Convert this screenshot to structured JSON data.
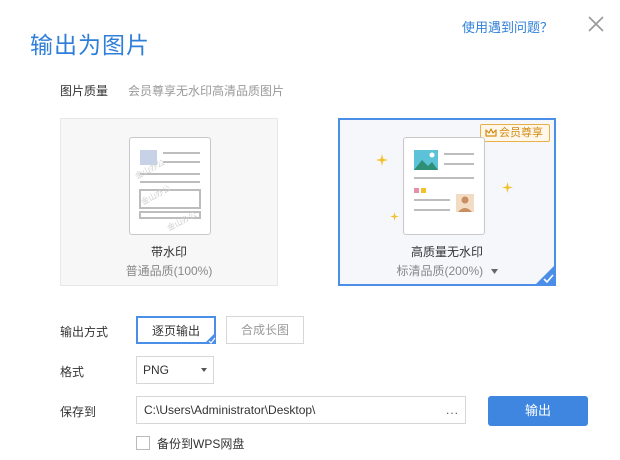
{
  "dialog": {
    "title": "输出为图片",
    "help_link": "使用遇到问题？"
  },
  "quality": {
    "label": "图片质量",
    "hint": "会员尊享无水印高清品质图片",
    "options": [
      {
        "title": "带水印",
        "subtitle": "普通品质(100%)",
        "watermark_text": "金山办公"
      },
      {
        "title": "高质量无水印",
        "subtitle": "标清品质(200%)",
        "badge": "会员尊享",
        "selected": true
      }
    ]
  },
  "output_mode": {
    "label": "输出方式",
    "options": [
      "逐页输出",
      "合成长图"
    ],
    "selected_index": 0
  },
  "format": {
    "label": "格式",
    "value": "PNG"
  },
  "save_to": {
    "label": "保存到",
    "path": "C:\\Users\\Administrator\\Desktop\\",
    "browse_label": "..."
  },
  "export_button": "输出",
  "backup": {
    "label": "备份到WPS网盘",
    "checked": false
  },
  "colors": {
    "accent": "#3f86e0",
    "selected_border": "#4a8ee8",
    "vip": "#d28a14",
    "star": "#f2c12e"
  }
}
